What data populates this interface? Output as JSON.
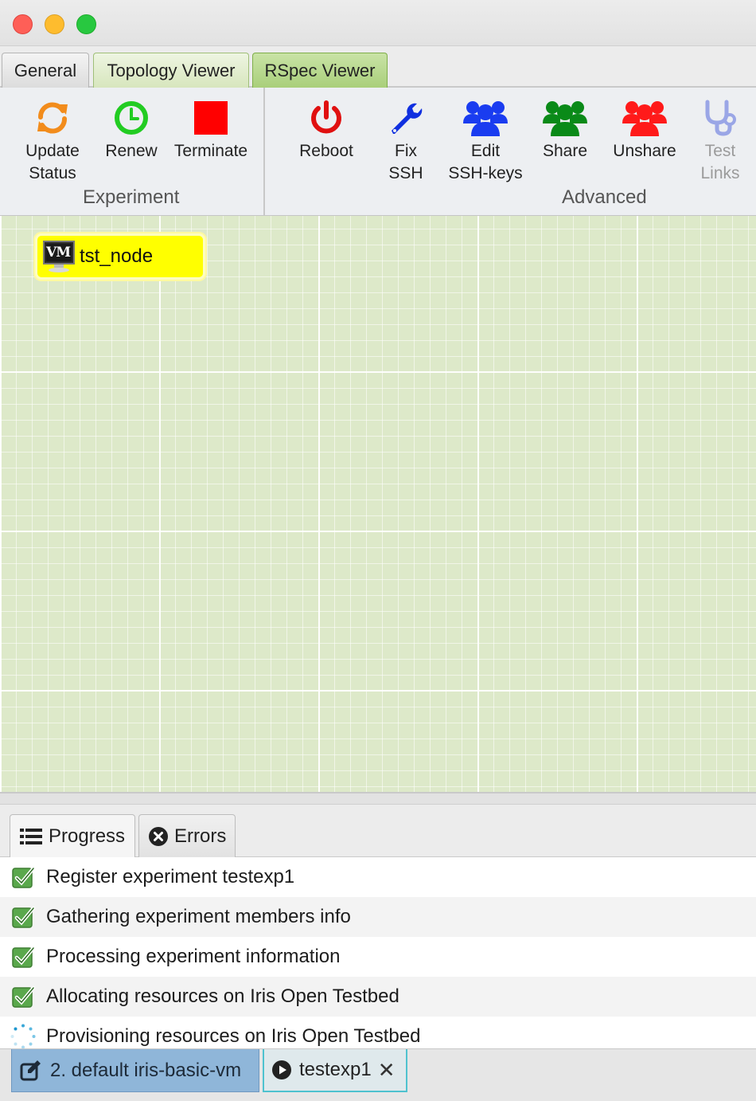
{
  "window": {
    "traffic_lights": [
      "close-button",
      "minimize-button",
      "zoom-button"
    ]
  },
  "tabs": [
    {
      "label": "General"
    },
    {
      "label": "Topology Viewer"
    },
    {
      "label": "RSpec Viewer"
    }
  ],
  "toolbar": {
    "experiment_group": "Experiment",
    "advanced_group": "Advanced",
    "update_status": "Update\nStatus",
    "renew": "Renew",
    "terminate": "Terminate",
    "reboot": "Reboot",
    "fix_ssh": "Fix\nSSH",
    "edit_ssh_keys": "Edit\nSSH-keys",
    "share": "Share",
    "unshare": "Unshare",
    "test_links": "Test\nLinks",
    "colors": {
      "update_status": "#f28c1c",
      "renew": "#22cc22",
      "terminate": "#ff0000",
      "reboot": "#e01010",
      "fix_ssh": "#1030e0",
      "edit_ssh_keys": "#1a3cf0",
      "share": "#0a8a18",
      "unshare": "#ff1a1a",
      "test_links_disabled": "#9aa6e6"
    }
  },
  "canvas": {
    "background": "#dde9c9",
    "node": {
      "badge": "VM",
      "label": "tst_node",
      "color": "#ffff00"
    }
  },
  "bottom_tabs": [
    {
      "label": "Progress",
      "icon": "list-icon"
    },
    {
      "label": "Errors",
      "icon": "error-circle-icon"
    }
  ],
  "progress": [
    {
      "text": "Register experiment testexp1",
      "status": "done"
    },
    {
      "text": "Gathering experiment members info",
      "status": "done"
    },
    {
      "text": "Processing experiment information",
      "status": "done"
    },
    {
      "text": "Allocating resources on Iris Open Testbed",
      "status": "done"
    },
    {
      "text": "Provisioning resources on Iris Open Testbed",
      "status": "in-progress"
    }
  ],
  "status_tabs": [
    {
      "label": "2. default iris-basic-vm",
      "icon": "edit-icon"
    },
    {
      "label": "testexp1",
      "icon": "play-circle-icon",
      "close": "✕"
    }
  ]
}
